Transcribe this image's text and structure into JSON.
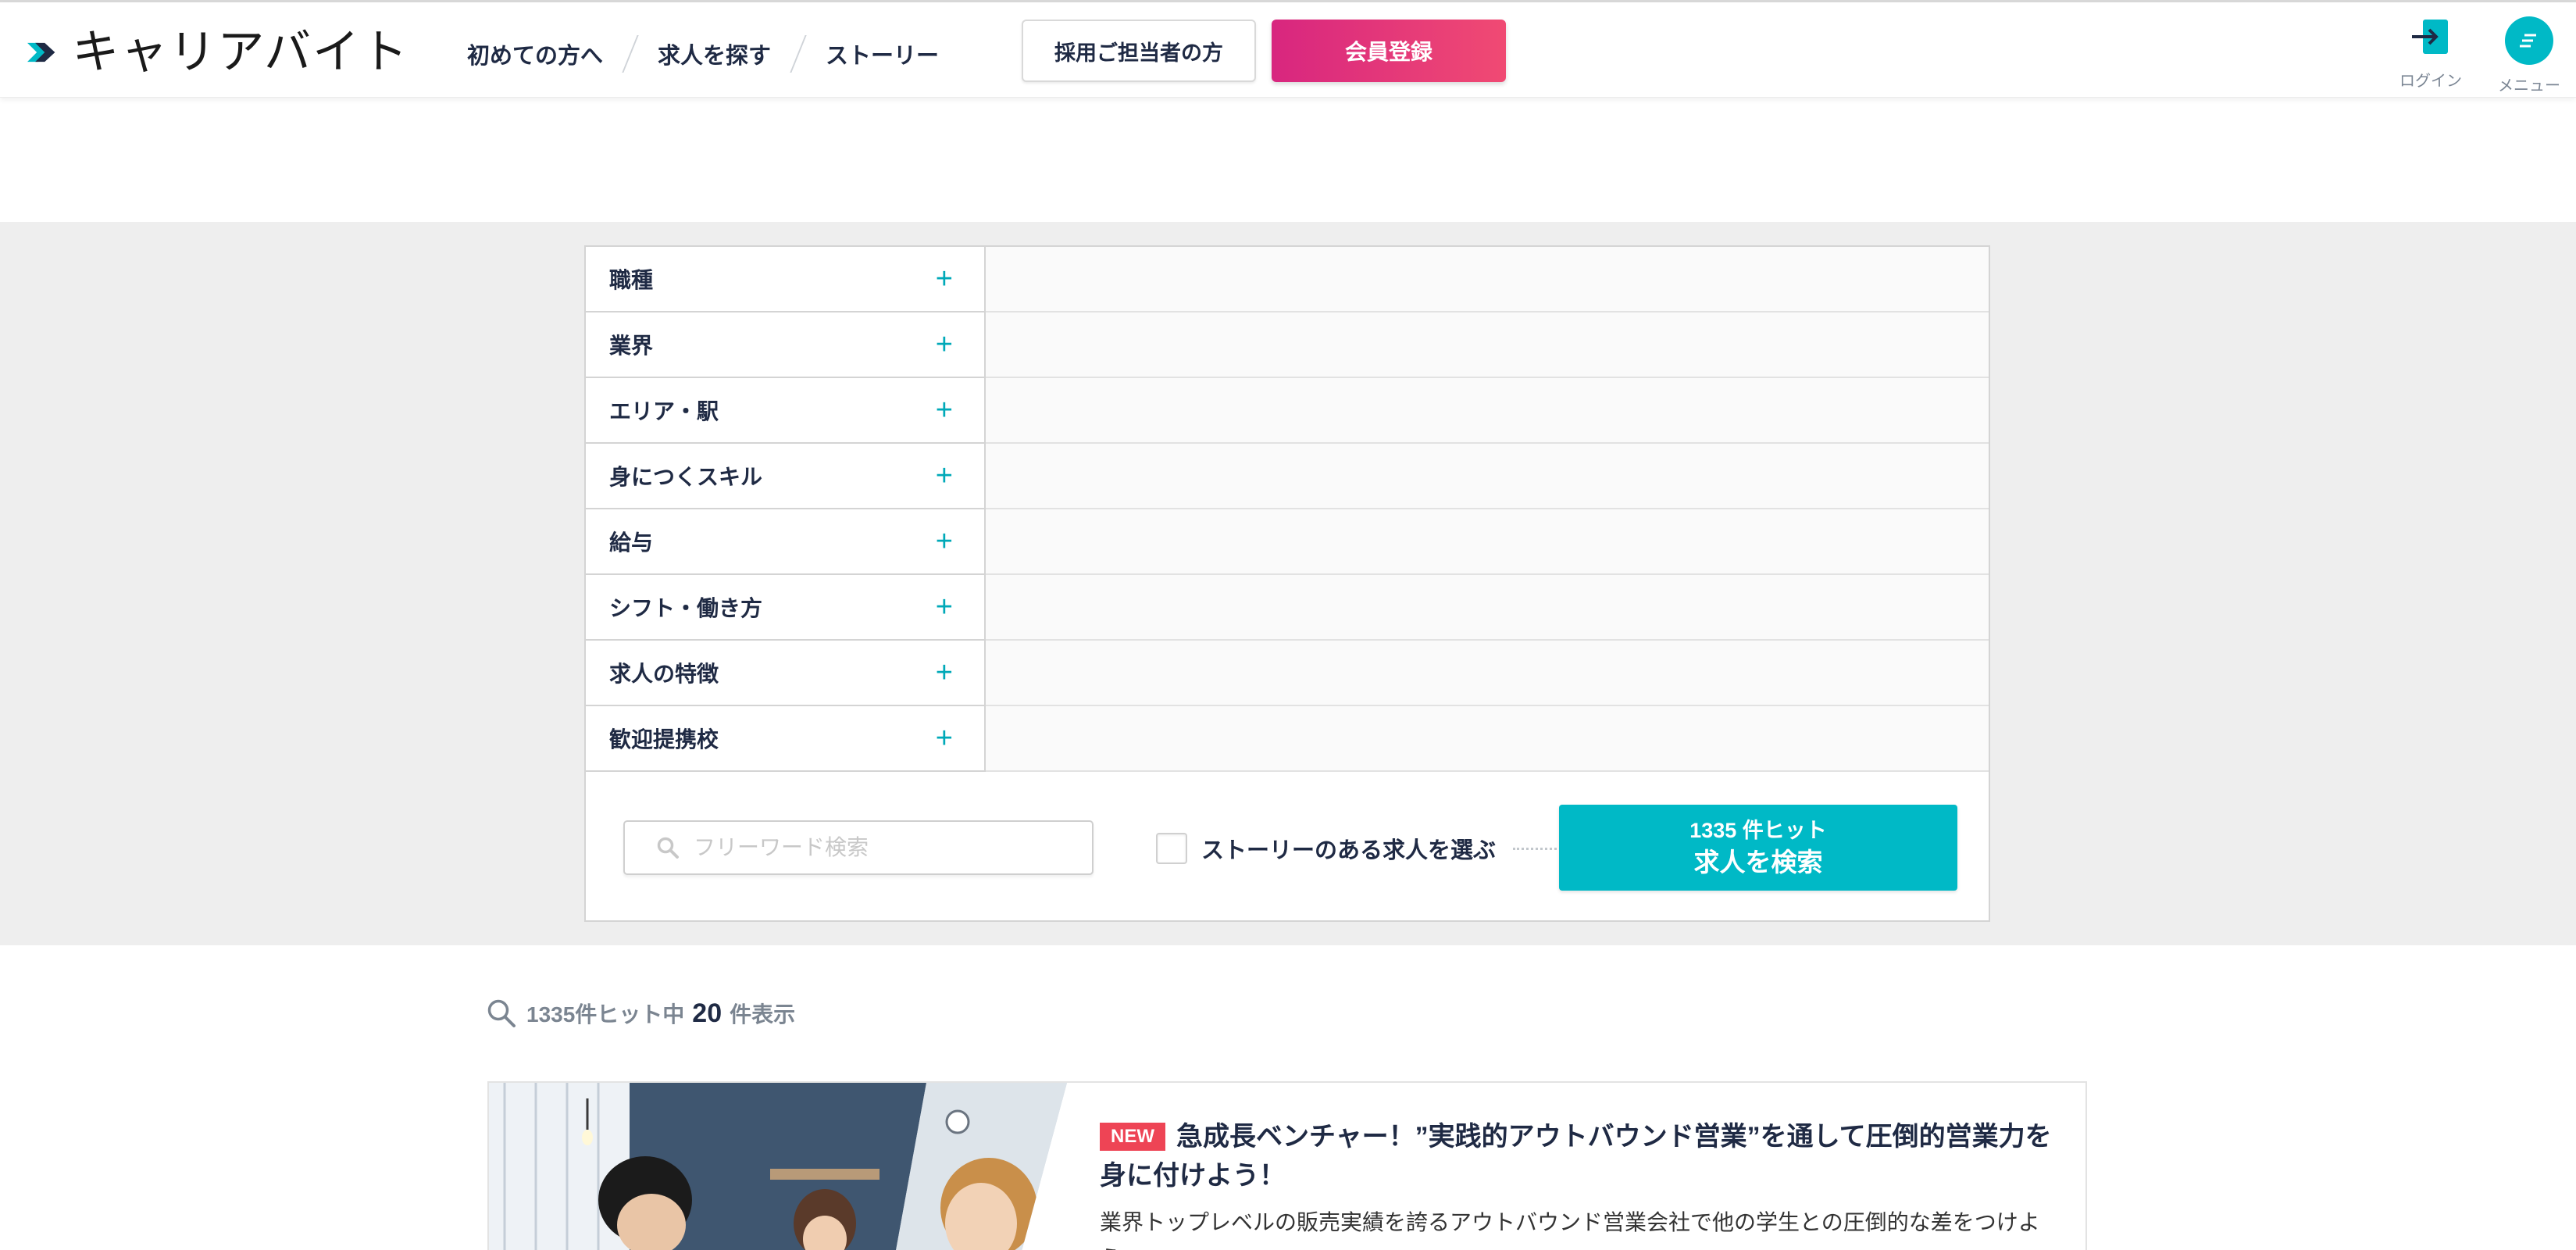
{
  "header": {
    "logo_text": "キャリアバイト",
    "nav": [
      "初めての方へ",
      "求人を探す",
      "ストーリー"
    ],
    "employer_button": "採用ご担当者の方",
    "register_button": "会員登録",
    "login_label": "ログイン",
    "menu_label": "メニュー",
    "brand_color": "#00b9c6",
    "register_color": "#e3306f"
  },
  "search": {
    "criteria": [
      "職種",
      "業界",
      "エリア・駅",
      "身につくスキル",
      "給与",
      "シフト・働き方",
      "求人の特徴",
      "歓迎提携校"
    ],
    "expand_symbol": "+",
    "free_word_placeholder": "フリーワード検索",
    "story_checkbox_label": "ストーリーのある求人を選ぶ",
    "story_checked": false,
    "button_hit_text": "1335 件ヒット",
    "button_label": "求人を検索"
  },
  "results": {
    "total_text": "1335件ヒット中",
    "shown_count": "20",
    "shown_suffix": "件表示"
  },
  "job": {
    "badge": "NEW",
    "title": "急成長ベンチャー！”実践的アウトバウンド営業”を通して圧倒的営業力を身に付けよう！",
    "description": "業界トップレベルの販売実績を誇るアウトバウンド営業会社で他の学生との圧倒的な差をつけよう。"
  }
}
